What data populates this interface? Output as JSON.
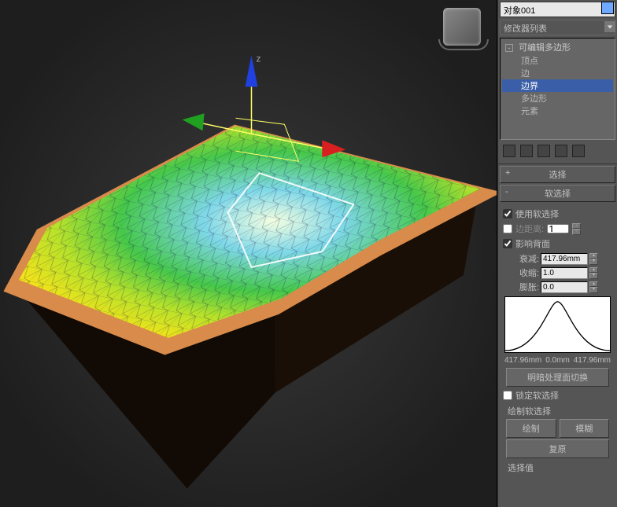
{
  "object_name": "对象001",
  "modifier_list_label": "修改器列表",
  "stack": {
    "root": "可编辑多边形",
    "subs": [
      "顶点",
      "边",
      "边界",
      "多边形",
      "元素"
    ],
    "selected_index": 2
  },
  "rollouts": {
    "selection": {
      "title": "选择",
      "toggle": "+"
    },
    "soft_selection": {
      "title": "软选择",
      "toggle": "-",
      "use_soft": {
        "label": "使用软选择",
        "checked": true
      },
      "edge_distance": {
        "label": "边距离:",
        "checked": false,
        "value": "1"
      },
      "affect_backfacing": {
        "label": "影响背面",
        "checked": true
      },
      "falloff": {
        "label": "衰减:",
        "value": "417.96mm"
      },
      "pinch": {
        "label": "收缩:",
        "value": "1.0"
      },
      "bubble": {
        "label": "膨胀:",
        "value": "0.0"
      },
      "curve_left": "417.96mm",
      "curve_mid": "0.0mm",
      "curve_right": "417.96mm",
      "shaded_toggle": "明暗处理面切换",
      "lock_soft": {
        "label": "锁定软选择",
        "checked": false
      },
      "paint_section": "绘制软选择",
      "paint_btn": "绘制",
      "blur_btn": "模糊",
      "revert_btn": "复原",
      "selection_value": "选择值"
    }
  }
}
